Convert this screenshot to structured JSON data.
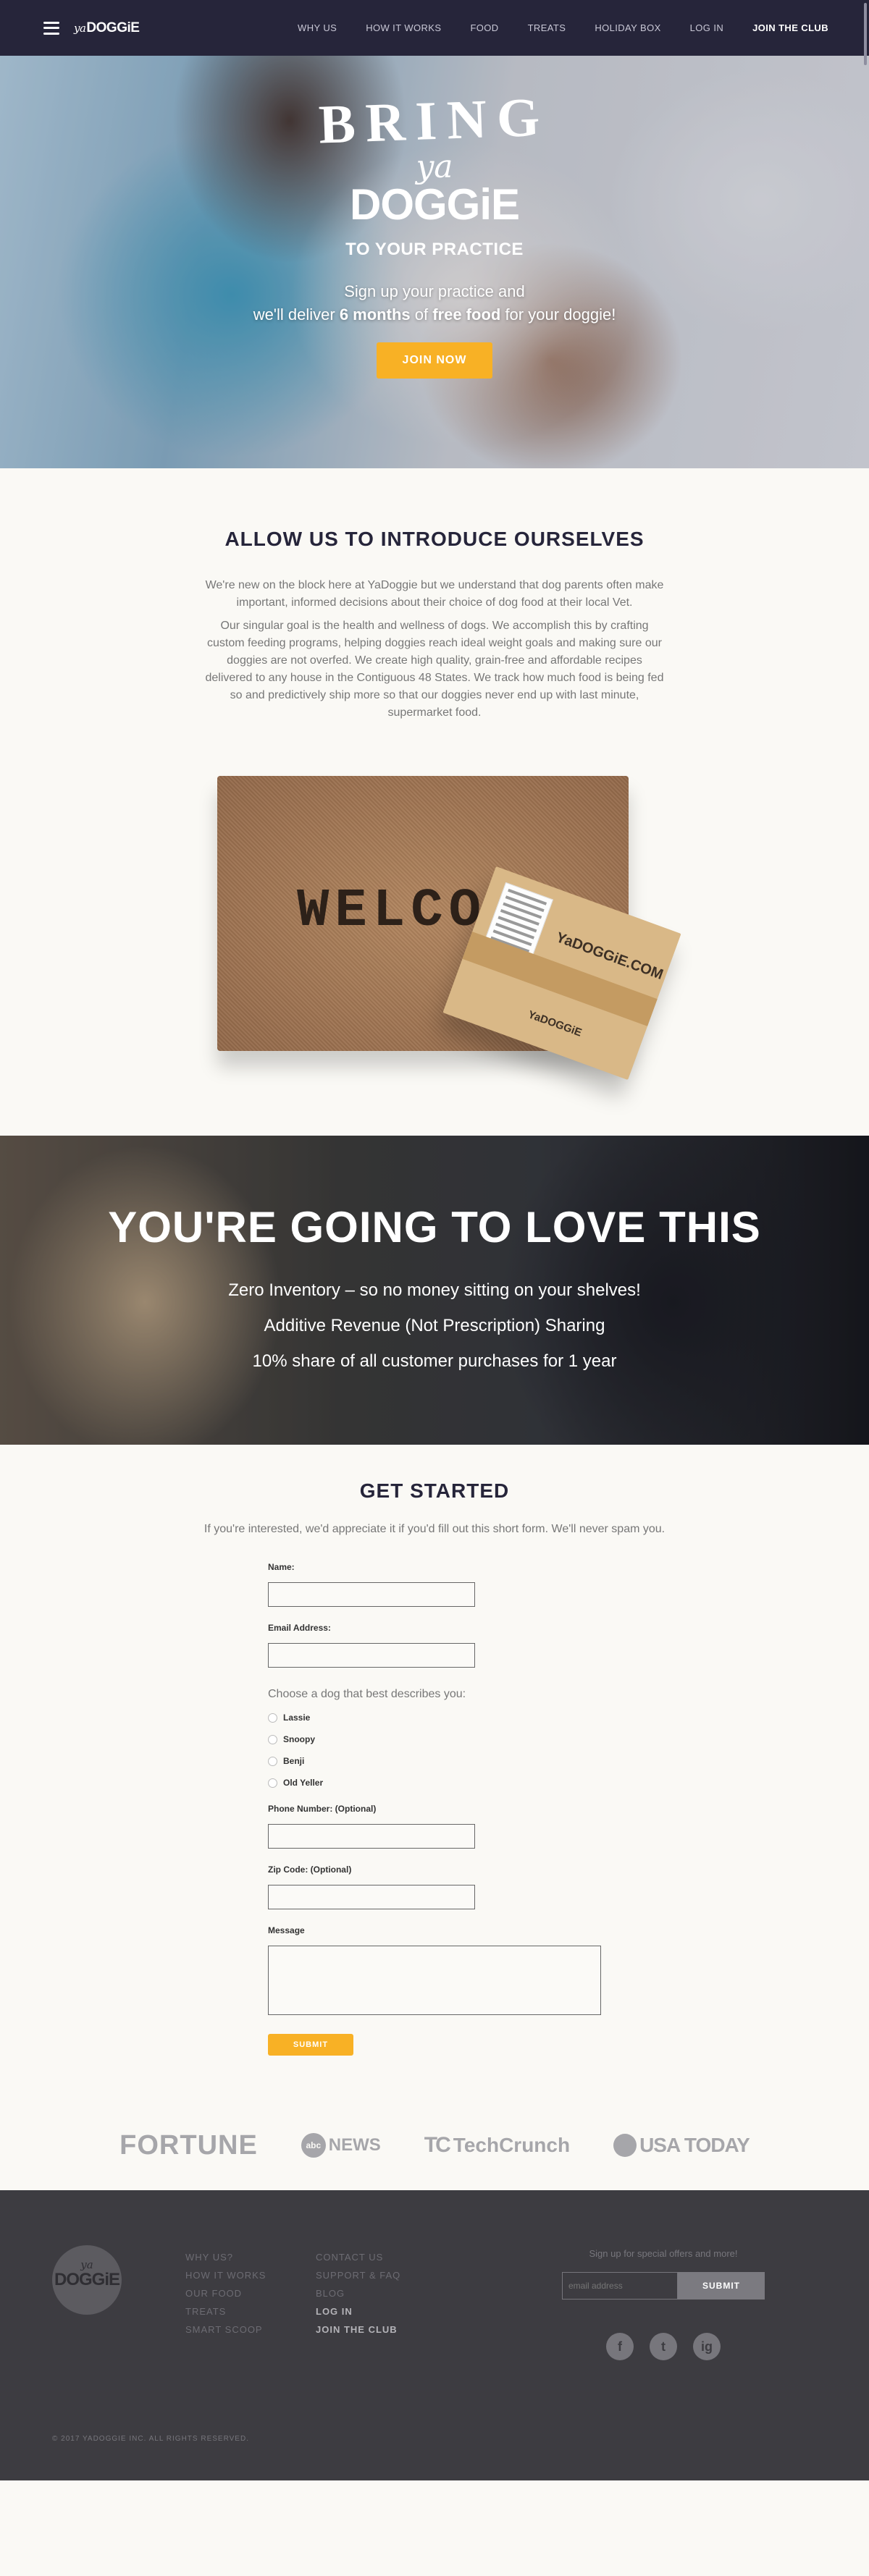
{
  "nav": {
    "logo_ya": "ya",
    "logo_doggie": "DOGGiE",
    "links": [
      "WHY US",
      "HOW IT WORKS",
      "FOOD",
      "TREATS",
      "HOLIDAY BOX",
      "LOG IN",
      "JOIN THE CLUB"
    ]
  },
  "hero": {
    "bring": "BRING",
    "ya": "ya",
    "doggie": "DOGGiE",
    "to_practice": "TO YOUR PRACTICE",
    "line1": "Sign up your practice and",
    "line2_pre": "we'll deliver ",
    "line2_bold1": "6 months",
    "line2_mid": " of ",
    "line2_bold2": "free food",
    "line2_post": " for your doggie!",
    "cta": "JOIN NOW"
  },
  "intro": {
    "title": "ALLOW US TO INTRODUCE OURSELVES",
    "p1": "We're new on the block here at YaDoggie but we understand that dog parents often make important, informed decisions about their choice of dog food at their local Vet.",
    "p2": "Our singular goal is the health and wellness of dogs. We accomplish this by crafting custom feeding programs, helping doggies reach ideal weight goals and making sure our doggies are not overfed. We create high quality, grain-free and affordable recipes delivered to any house in the Contiguous 48 States. We track how much food is being fed so and predictively ship more so that our doggies never end up with last minute, supermarket food.",
    "mat_text": "WELCO",
    "box_logo": "YaDOGGiE.COM",
    "box_logo2": "YaDOGGiE"
  },
  "love": {
    "title": "YOU'RE GOING TO LOVE THIS",
    "items": [
      "Zero Inventory – so no money sitting on your shelves!",
      "Additive Revenue (Not Prescription) Sharing",
      "10% share of all customer purchases for 1 year"
    ]
  },
  "form": {
    "title": "GET STARTED",
    "lead": "If you're interested, we'd appreciate it if you'd fill out this short form. We'll never spam you.",
    "name_label": "Name:",
    "email_label": "Email Address:",
    "choose": "Choose a dog that best describes you:",
    "dogs": [
      "Lassie",
      "Snoopy",
      "Benji",
      "Old Yeller"
    ],
    "phone_label": "Phone Number: (Optional)",
    "zip_label": "Zip Code: (Optional)",
    "message_label": "Message",
    "submit": "SUBMIT"
  },
  "press": {
    "fortune": "FORTUNE",
    "abc_mark": "abc",
    "abc_news": "NEWS",
    "tc_mark": "TC",
    "techcrunch": "TechCrunch",
    "usatoday": "USA TODAY"
  },
  "footer": {
    "logo_ya": "ya",
    "logo_doggie": "DOGGiE",
    "col1": [
      "WHY US?",
      "HOW IT WORKS",
      "OUR FOOD",
      "TREATS",
      "SMART SCOOP"
    ],
    "col2": [
      "CONTACT US",
      "SUPPORT & FAQ",
      "BLOG",
      "LOG IN",
      "JOIN THE CLUB"
    ],
    "signup_text": "Sign up for special offers and more!",
    "email_placeholder": "email address",
    "submit": "SUBMIT",
    "social": [
      "f",
      "t",
      "ig"
    ],
    "copyright": "© 2017 YADOGGIE INC. ALL RIGHTS RESERVED."
  }
}
